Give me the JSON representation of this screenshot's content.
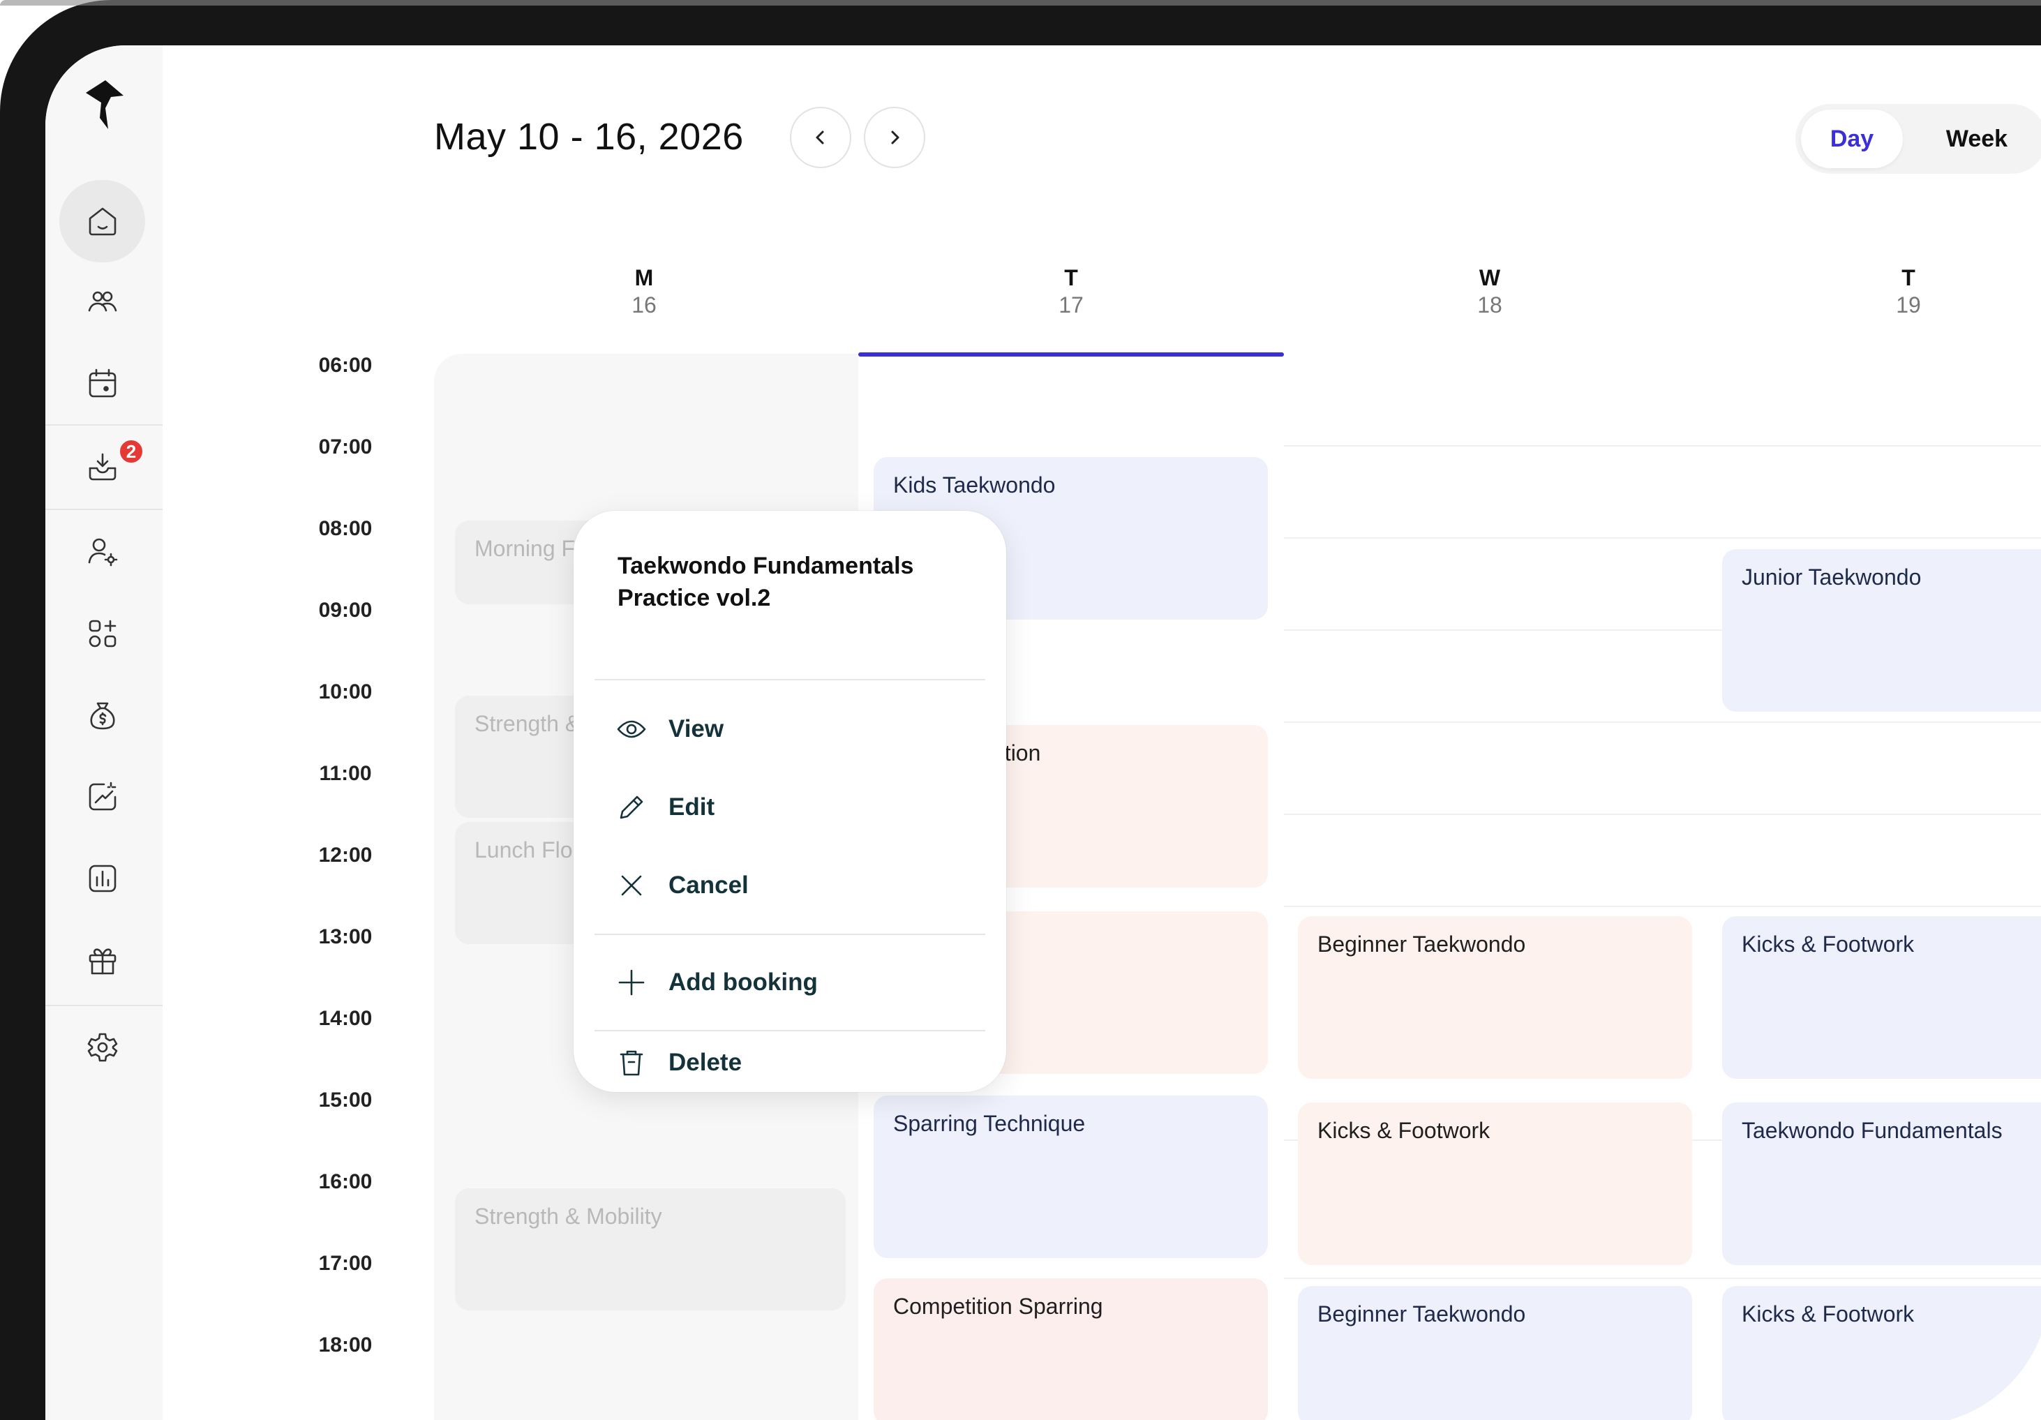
{
  "header": {
    "date_range": "May 10 - 16, 2026",
    "view_day": "Day",
    "view_week": "Week"
  },
  "sidebar": {
    "inbox_badge": "2",
    "items": [
      "home",
      "members",
      "calendar",
      "inbox",
      "staff-settings",
      "apps",
      "finances",
      "marketing",
      "reports",
      "gifts",
      "settings"
    ]
  },
  "days": [
    {
      "letter": "M",
      "number": "16"
    },
    {
      "letter": "T",
      "number": "17"
    },
    {
      "letter": "W",
      "number": "18"
    },
    {
      "letter": "T",
      "number": "19"
    }
  ],
  "times": [
    "06:00",
    "07:00",
    "08:00",
    "09:00",
    "10:00",
    "11:00",
    "12:00",
    "13:00",
    "14:00",
    "15:00",
    "16:00",
    "17:00",
    "18:00"
  ],
  "events": {
    "mon": [
      "Morning F",
      "Strength &",
      "Lunch Flo",
      "Strength & Mobility"
    ],
    "tue": [
      "Kids Taekwondo",
      "ation",
      "Sparring Technique",
      "Competition Sparring"
    ],
    "wed": [
      "Beginner Taekwondo",
      "Kicks & Footwork",
      "Beginner Taekwondo"
    ],
    "thu": [
      "Junior Taekwondo",
      "Kicks & Footwork",
      "Taekwondo Fundamentals",
      "Kicks & Footwork"
    ]
  },
  "popup": {
    "title": "Taekwondo Fundamentals Practice vol.2",
    "view": "View",
    "edit": "Edit",
    "cancel": "Cancel",
    "add_booking": "Add booking",
    "delete": "Delete"
  },
  "colors": {
    "accent": "#3b2fd9",
    "event_blue": "#eef0fb",
    "event_peach": "#fdf2ee",
    "badge": "#e53935"
  }
}
